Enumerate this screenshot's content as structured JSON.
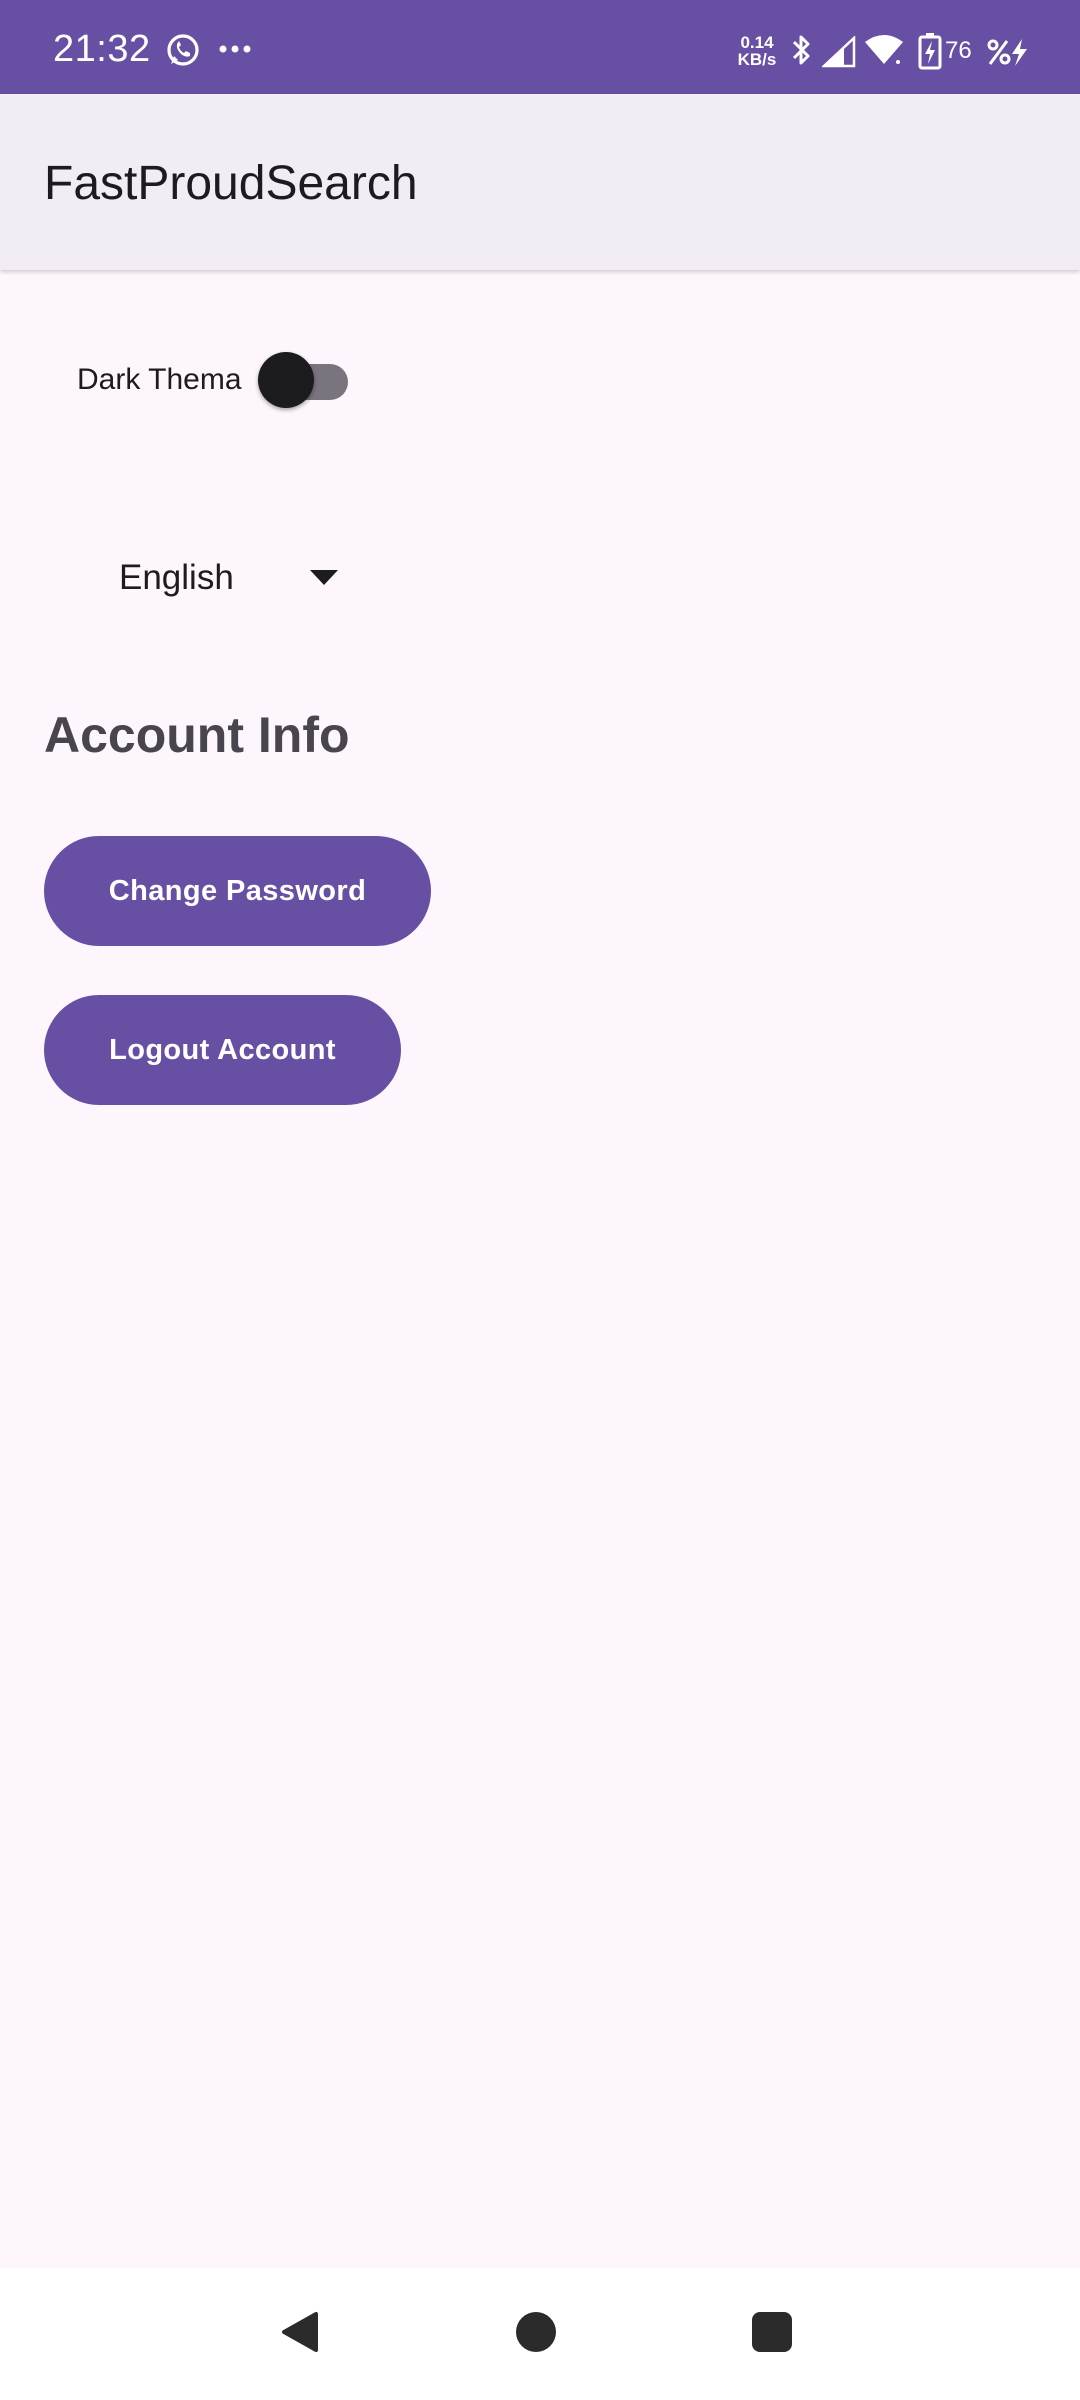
{
  "status_bar": {
    "time": "21:32",
    "net_speed_value": "0.14",
    "net_speed_unit": "KB/s",
    "battery_level": "76",
    "icons": [
      "whatsapp-icon",
      "more-icon",
      "bluetooth-icon",
      "signal-icon",
      "wifi-icon",
      "battery-icon",
      "charging-icon"
    ]
  },
  "app_bar": {
    "title": "FastProudSearch"
  },
  "settings": {
    "dark_theme_label": "Dark Thema",
    "dark_theme_enabled": false,
    "language": {
      "selected": "English"
    }
  },
  "account": {
    "section_title": "Account Info",
    "change_password_label": "Change Password",
    "logout_label": "Logout Account"
  },
  "nav_bar": {
    "icons": [
      "back-icon",
      "home-icon",
      "recents-icon"
    ]
  },
  "colors": {
    "primary": "#6750a4",
    "app_bar_bg": "#f2ecf5",
    "background": "#fdf7fd",
    "switch_track_off": "#79747e"
  }
}
